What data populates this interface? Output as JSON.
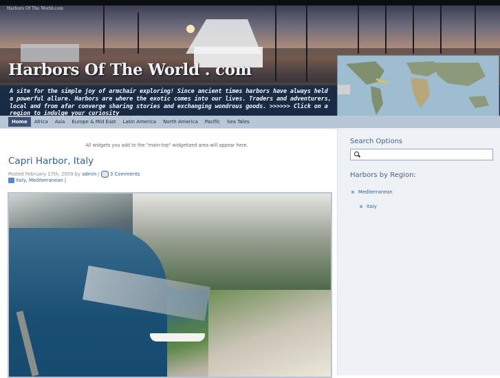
{
  "site": {
    "small_title": "Harbors Of The World.com",
    "title": "Harbors Of The World . com",
    "tagline": "A site for the simple joy of armchair exploring! Since ancient times harbors have always held a powerful allure. Harbors are where the exotic comes into our lives. Traders and adventurers, local and from afar converge sharing stories and exchanging wondrous goods. >>>>>> Click on a region to indulge your curiosity"
  },
  "nav": {
    "items": [
      "Home",
      "Africa",
      "Asia",
      "Europe & Mid East",
      "Latin America",
      "North America",
      "Pacific",
      "Sea Tales"
    ],
    "active": "Home"
  },
  "main": {
    "widget_message": "All widgets you add to the \"main-top\" widgetized area will appear here.",
    "post": {
      "title": "Capri Harbor, Italy",
      "posted_prefix": "Posted February 17th, 2009 by",
      "author": "admin",
      "comments": "3 Comments",
      "categories": "Italy, Mediterranean"
    }
  },
  "sidebar": {
    "search_heading": "Search Options",
    "region_heading": "Harbors by Region:",
    "regions": [
      "Mediterranean",
      "Italy"
    ]
  },
  "icons": [
    "search-icon",
    "comment-icon",
    "tag-icon",
    "world-map"
  ]
}
